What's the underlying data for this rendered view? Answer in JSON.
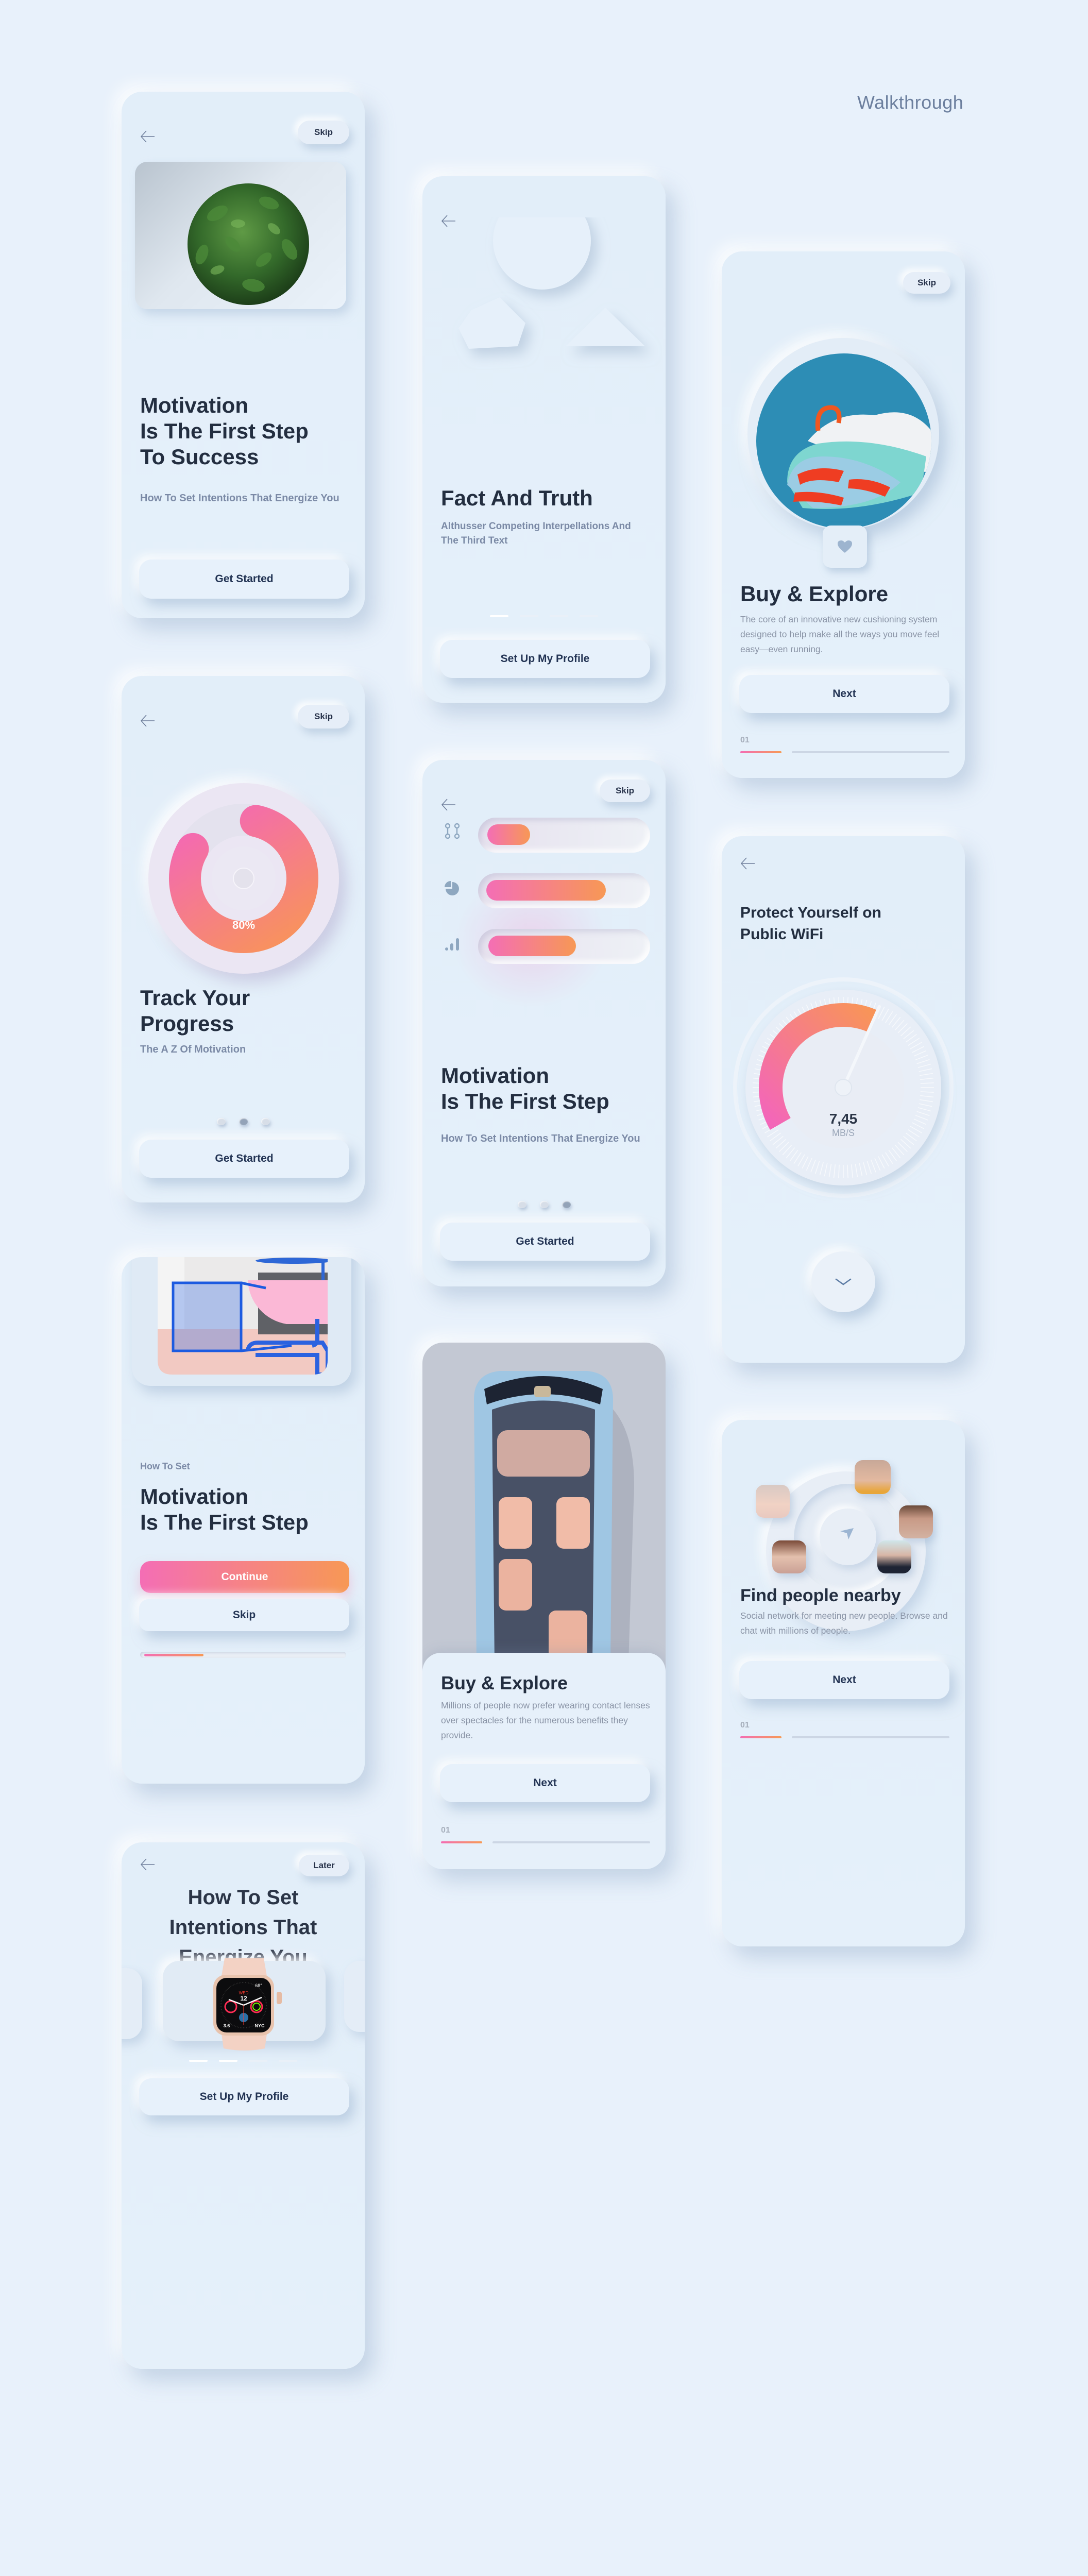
{
  "page": {
    "title": "Walkthrough"
  },
  "colors": {
    "background": "#e8f1fb",
    "accent_start": "#f46eb5",
    "accent_end": "#f79855",
    "heading": "#232e40",
    "subtitle": "#7b8aa6"
  },
  "cards": {
    "plant": {
      "skip_label": "Skip",
      "title_lines": [
        "Motivation",
        "Is The First Step",
        "To Success"
      ],
      "subtitle": "How To Set Intentions That Energize You",
      "button_label": "Get Started",
      "image": "plant-photo"
    },
    "shapes": {
      "title": "Fact And Truth",
      "subtitle": "Althusser Competing Interpellations And The Third Text",
      "button_label": "Set Up My Profile",
      "pager": {
        "count": 4,
        "active": 1
      }
    },
    "shoe": {
      "skip_label": "Skip",
      "title": "Buy & Explore",
      "body": "The core of an innovative new cushioning system designed to help make all the ways you move feel easy—even running.",
      "button_label": "Next",
      "step_label": "01",
      "image": "sneaker-photo"
    },
    "progress": {
      "skip_label": "Skip",
      "ring_percent": 80,
      "ring_label": "80%",
      "title_lines": [
        "Track Your",
        "Progress"
      ],
      "subtitle": "The A Z Of Motivation",
      "button_label": "Get Started",
      "pager": {
        "count": 3,
        "active": 2
      }
    },
    "bars": {
      "skip_label": "Skip",
      "bars": [
        {
          "icon": "connection-icon",
          "value": 28
        },
        {
          "icon": "pie-chart-icon",
          "value": 78
        },
        {
          "icon": "signal-icon",
          "value": 57
        }
      ],
      "title_lines": [
        "Motivation",
        "Is The First Step"
      ],
      "subtitle": "How To Set Intentions That Energize You",
      "button_label": "Get Started",
      "pager": {
        "count": 3,
        "active": 3
      }
    },
    "wifi": {
      "title_lines": [
        "Protect Yourself on",
        "Public WiFi"
      ],
      "speed_value": "7,45",
      "speed_unit": "MB/S",
      "gauge_fraction": 0.6
    },
    "furniture": {
      "eyebrow": "How To Set",
      "title_lines": [
        "Motivation",
        "Is The First Step"
      ],
      "continue_label": "Continue",
      "skip_label": "Skip",
      "progress_percent": 30,
      "image": "furniture-photo"
    },
    "car": {
      "title": "Buy & Explore",
      "body": "Millions of people now prefer wearing contact lenses over spectacles for the numerous benefits they provide.",
      "button_label": "Next",
      "step_label": "01",
      "image": "car-photo"
    },
    "people": {
      "title": "Find people nearby",
      "body": "Social network for meeting new people. Browse and chat with millions of people.",
      "button_label": "Next",
      "step_label": "01",
      "avatars": [
        "avatar-woman-1",
        "avatar-woman-2",
        "avatar-man-1",
        "avatar-woman-3",
        "avatar-man-2"
      ]
    },
    "watch": {
      "later_label": "Later",
      "title_lines": [
        "How To Set",
        "Intentions That",
        "Energize You"
      ],
      "button_label": "Set Up My Profile",
      "pager": {
        "count": 4,
        "active": 2
      },
      "watch_face": {
        "day": "WED",
        "date": "12",
        "temp": "68°",
        "top_text": "11:15AM TRAINING WITH KRISTA",
        "bottom_left": "3.6",
        "bottom_right": "NYC"
      }
    }
  }
}
